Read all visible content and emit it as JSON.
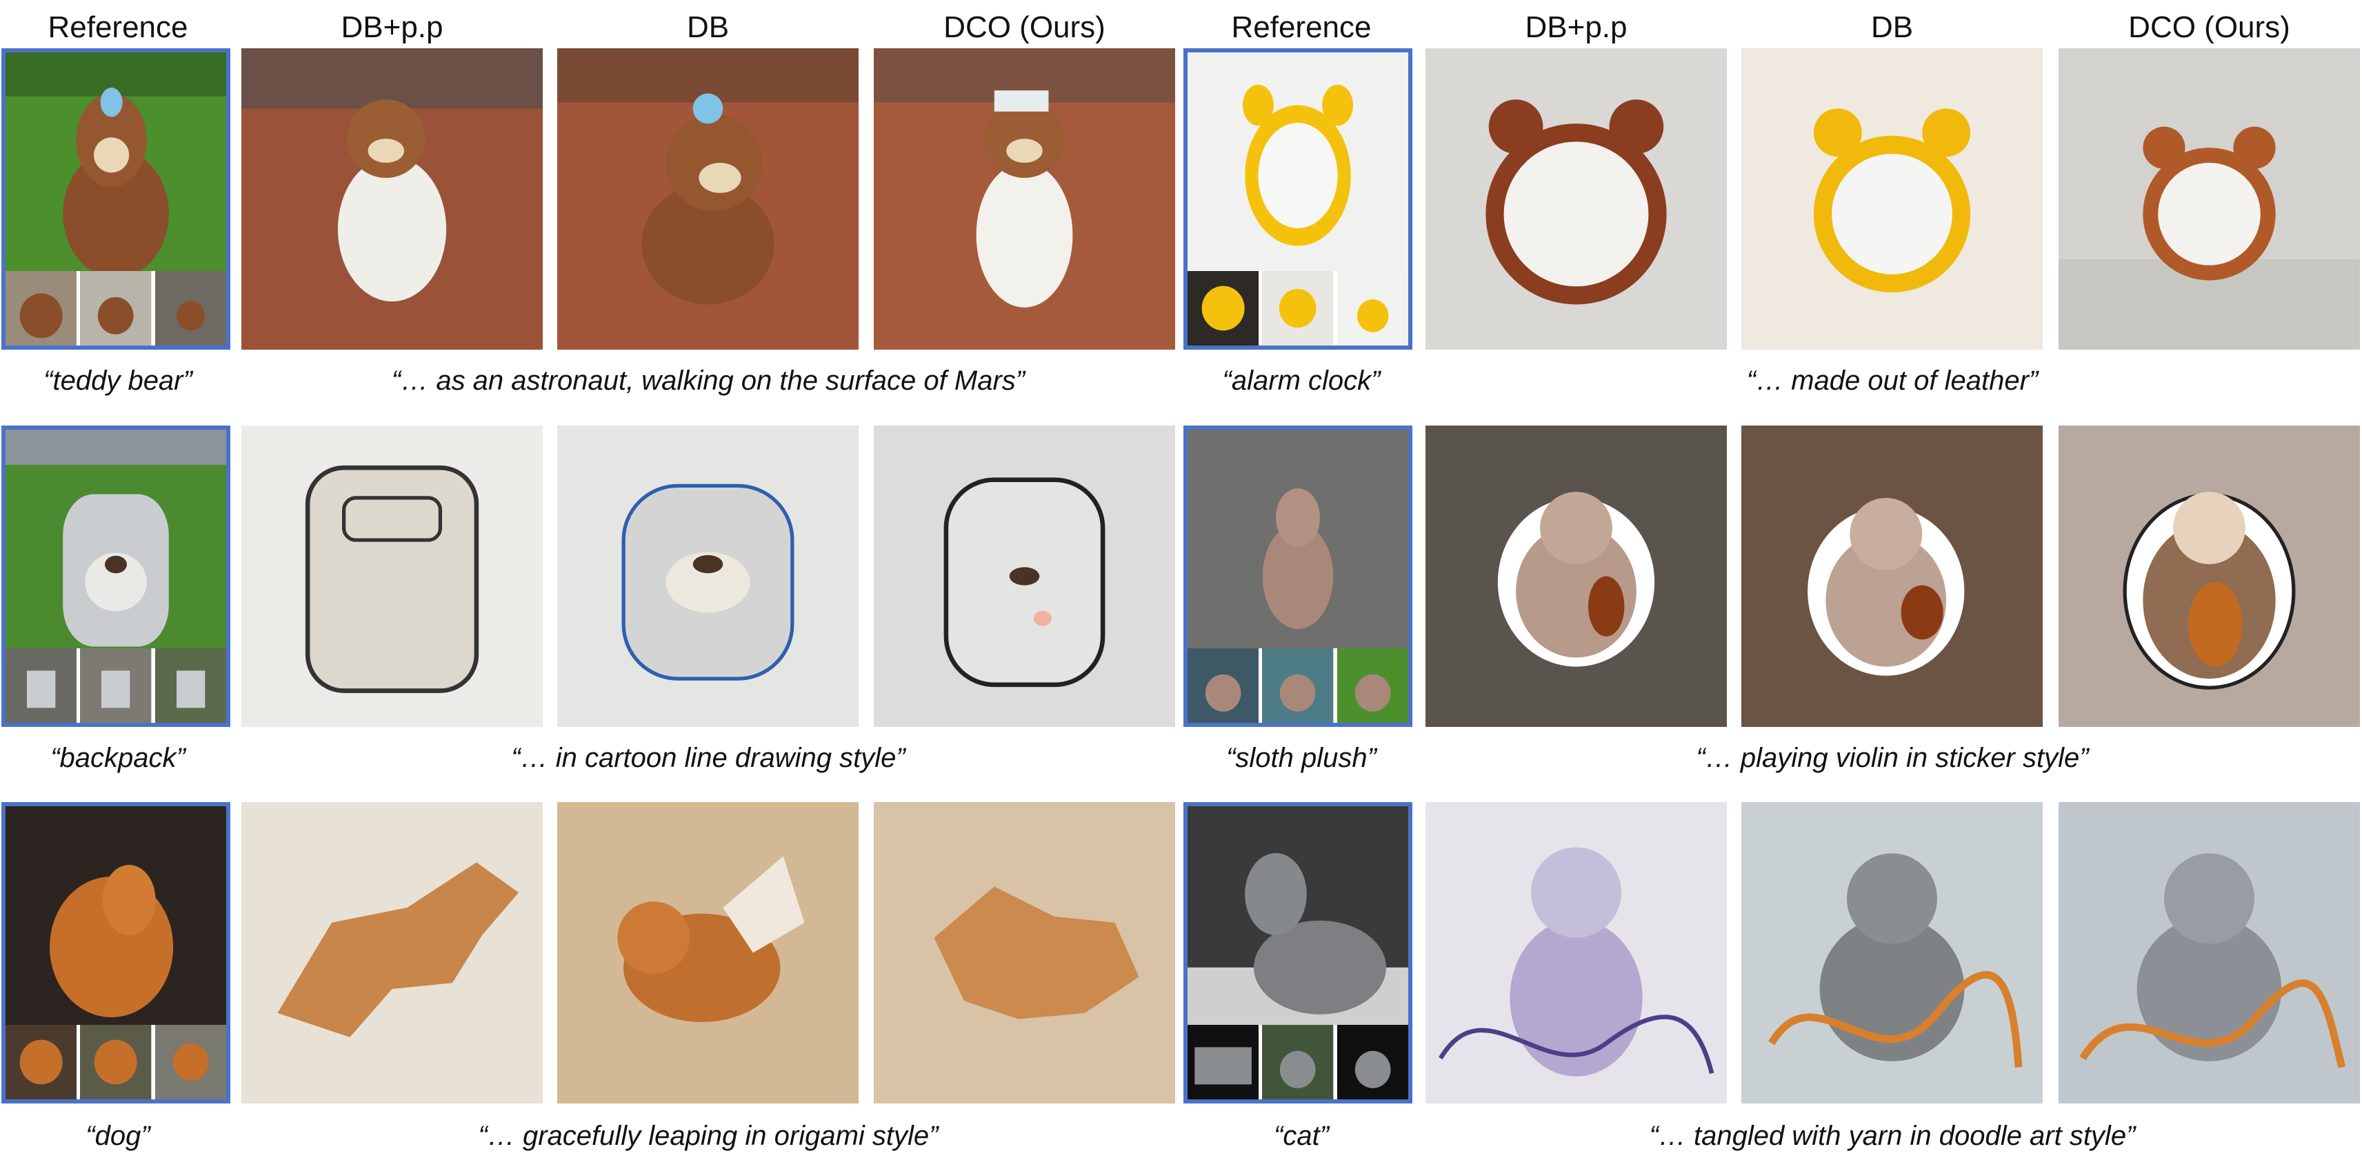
{
  "headers": [
    "Reference",
    "DB+p.p",
    "DB",
    "DCO (Ours)",
    "Reference",
    "DB+p.p",
    "DB",
    "DCO (Ours)"
  ],
  "rows": [
    {
      "left": {
        "subject_caption": "“teddy bear”",
        "prompt_caption": "“… as an astronaut, walking on the surface of Mars”"
      },
      "right": {
        "subject_caption": "“alarm clock”",
        "prompt_caption": "“… made out of leather”"
      }
    },
    {
      "left": {
        "subject_caption": "“backpack”",
        "prompt_caption": "“… in cartoon line drawing style”"
      },
      "right": {
        "subject_caption": "“sloth plush”",
        "prompt_caption": "“… playing violin in sticker style”"
      }
    },
    {
      "left": {
        "subject_caption": "“dog”",
        "prompt_caption": "“… gracefully leaping in origami style”"
      },
      "right": {
        "subject_caption": "“cat”",
        "prompt_caption": "“… tangled with yarn in doodle art style”"
      }
    }
  ],
  "colors": {
    "reference_border": "#4a72c8",
    "text": "#111111",
    "background": "#ffffff"
  }
}
